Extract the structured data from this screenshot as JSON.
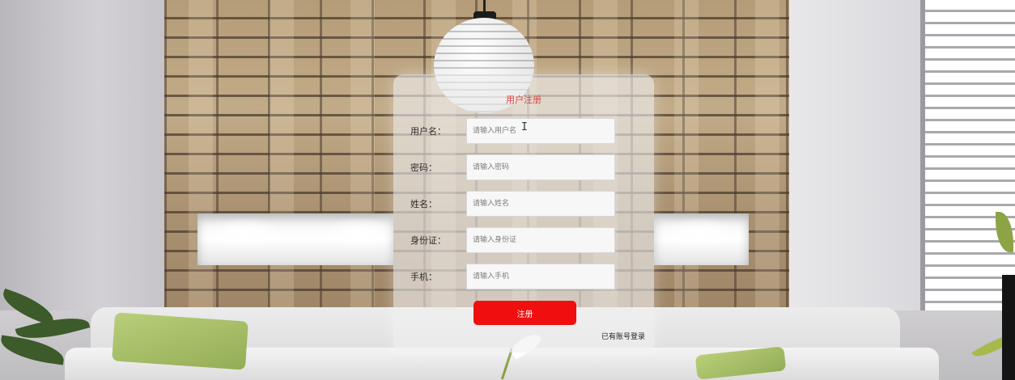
{
  "form": {
    "title": "用户注册",
    "fields": [
      {
        "label": "用户名：",
        "placeholder": "请输入用户名",
        "value": ""
      },
      {
        "label": "密码：",
        "placeholder": "请输入密码",
        "value": ""
      },
      {
        "label": "姓名：",
        "placeholder": "请输入姓名",
        "value": ""
      },
      {
        "label": "身份证：",
        "placeholder": "请输入身份证",
        "value": ""
      },
      {
        "label": "手机：",
        "placeholder": "请输入手机",
        "value": ""
      }
    ],
    "submit_label": "注册",
    "login_link": "已有账号登录"
  },
  "colors": {
    "accent": "#ef0f0f",
    "title": "#e0413b",
    "panel": "#f0f0f2"
  }
}
